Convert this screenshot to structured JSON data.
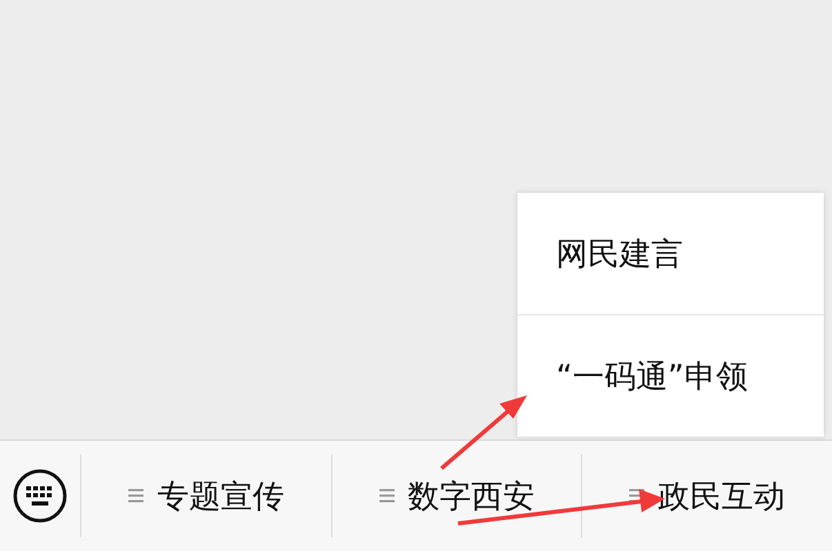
{
  "menu_bar": {
    "items": [
      {
        "label": "专题宣传",
        "has_submenu": true
      },
      {
        "label": "数字西安",
        "has_submenu": true
      },
      {
        "label": "政民互动",
        "has_submenu": true,
        "submenu": [
          {
            "label": "网民建言"
          },
          {
            "label": "“一码通”申领"
          }
        ]
      }
    ]
  }
}
